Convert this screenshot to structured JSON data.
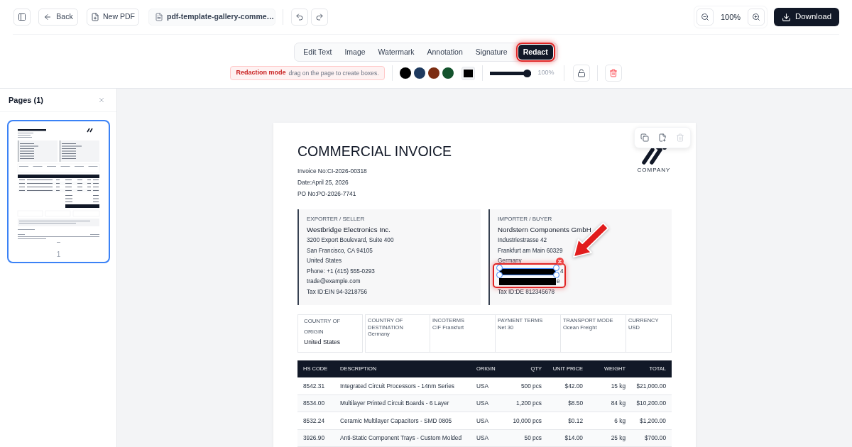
{
  "toolbar": {
    "back": "Back",
    "new_pdf": "New PDF",
    "file_name": "pdf-template-gallery-comme…",
    "zoom": "100%",
    "download": "Download"
  },
  "tabs": [
    {
      "label": "Edit Text",
      "selected": false,
      "highlighted": false
    },
    {
      "label": "Image",
      "selected": false,
      "highlighted": false
    },
    {
      "label": "Watermark",
      "selected": false,
      "highlighted": false
    },
    {
      "label": "Annotation",
      "selected": false,
      "highlighted": false
    },
    {
      "label": "Signature",
      "selected": false,
      "highlighted": false
    },
    {
      "label": "Redact",
      "selected": true,
      "highlighted": true
    }
  ],
  "redact_tools": {
    "mode_label": "Redaction mode",
    "hint": "drag on the page to create boxes.",
    "swatches": [
      {
        "color": "#000000"
      },
      {
        "color": "#1e3a5f"
      },
      {
        "color": "#7c2d12"
      },
      {
        "color": "#14532d"
      }
    ],
    "fill": {
      "color": "#000000"
    },
    "opacity": {
      "level": 1,
      "reading": "100%"
    },
    "locked": false
  },
  "pages_panel": {
    "title": "Pages (1)",
    "pages": [
      {
        "number": "1",
        "selected": true
      }
    ]
  },
  "object_toolbar": {
    "delete_disabled": true
  },
  "invoice": {
    "title": "COMMERCIAL INVOICE",
    "company": "COMPANY",
    "meta": [
      "Invoice No:CI-2026-00318",
      "Date:April 25, 2026",
      "PO No:PO-2026-7741"
    ],
    "parties": [
      {
        "label": "EXPORTER / SELLER",
        "name": "Westbridge Electronics Inc.",
        "lines": [
          {
            "kind": "text",
            "text": "3200 Export Boulevard, Suite 400"
          },
          {
            "kind": "text",
            "text": "San Francisco, CA 94105"
          },
          {
            "kind": "text",
            "text": "United States"
          },
          {
            "kind": "text",
            "text": "Phone: +1 (415) 555-0293"
          },
          {
            "kind": "text",
            "text": "trade@example.com"
          },
          {
            "kind": "text",
            "text": "Tax ID:EIN 94-3218756"
          }
        ]
      },
      {
        "label": "IMPORTER / BUYER",
        "name": "Nordstern Components GmbH",
        "redactions_highlighted": true,
        "lines": [
          {
            "kind": "text",
            "text": "Industriestrasse 42"
          },
          {
            "kind": "text",
            "text": "Frankfurt am Main 60329"
          },
          {
            "kind": "text",
            "text": "Germany"
          },
          {
            "kind": "redacted",
            "text": "4",
            "selected": true
          },
          {
            "kind": "redacted",
            "text": "e",
            "selected": false
          },
          {
            "kind": "text",
            "text": "Tax ID:DE 812345678"
          }
        ]
      }
    ],
    "terms": [
      {
        "kind": "boxed",
        "label": "COUNTRY OF ORIGIN",
        "value": "United States"
      },
      {
        "kind": "compact",
        "label": "COUNTRY OF DESTINATION",
        "value": "Germany"
      },
      {
        "kind": "compact",
        "label": "INCOTERMS",
        "value": "CIF Frankfurt"
      },
      {
        "kind": "compact",
        "label": "PAYMENT TERMS",
        "value": "Net 30"
      },
      {
        "kind": "compact",
        "label": "TRANSPORT MODE",
        "value": "Ocean Freight"
      },
      {
        "kind": "compact",
        "label": "CURRENCY",
        "value": "USD"
      }
    ],
    "table": {
      "columns": [
        "HS CODE",
        "DESCRIPTION",
        "ORIGIN",
        "QTY",
        "UNIT PRICE",
        "WEIGHT",
        "TOTAL"
      ],
      "rows": [
        [
          "8542.31",
          "Integrated Circuit Processors - 14nm Series",
          "USA",
          "500 pcs",
          "$42.00",
          "15 kg",
          "$21,000.00"
        ],
        [
          "8534.00",
          "Multilayer Printed Circuit Boards - 6 Layer",
          "USA",
          "1,200 pcs",
          "$8.50",
          "84 kg",
          "$10,200.00"
        ],
        [
          "8532.24",
          "Ceramic Multilayer Capacitors - SMD 0805",
          "USA",
          "10,000 pcs",
          "$0.12",
          "6 kg",
          "$1,200.00"
        ],
        [
          "3926.90",
          "Anti-Static Component Trays - Custom Molded",
          "USA",
          "50 pcs",
          "$14.00",
          "25 kg",
          "$700.00"
        ]
      ]
    }
  }
}
